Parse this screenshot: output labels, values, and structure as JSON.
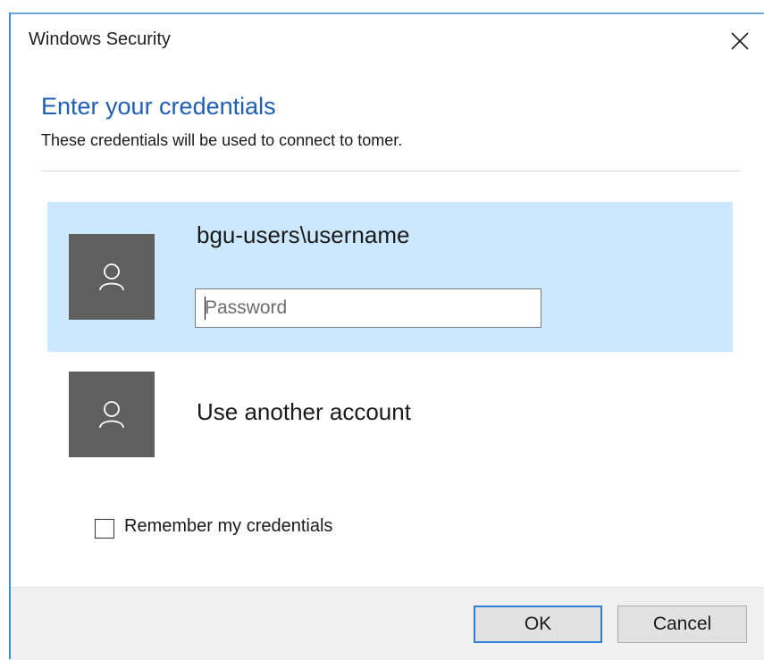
{
  "window": {
    "title": "Windows Security"
  },
  "header": {
    "title": "Enter your credentials",
    "subtitle": "These credentials will be used to connect to tomer."
  },
  "accounts": [
    {
      "name": "bgu-users\\username",
      "icon": "user-icon",
      "selected": true,
      "password_placeholder": "Password",
      "password_value": ""
    },
    {
      "name": "Use another account",
      "icon": "user-icon",
      "selected": false
    }
  ],
  "remember": {
    "label": "Remember my credentials",
    "checked": false
  },
  "buttons": {
    "ok_label": "OK",
    "cancel_label": "Cancel"
  },
  "colors": {
    "accent": "#1f5fb3",
    "selection": "#cce8ff",
    "avatar": "#5f5f5f",
    "focus_border": "#2f7fd3"
  }
}
